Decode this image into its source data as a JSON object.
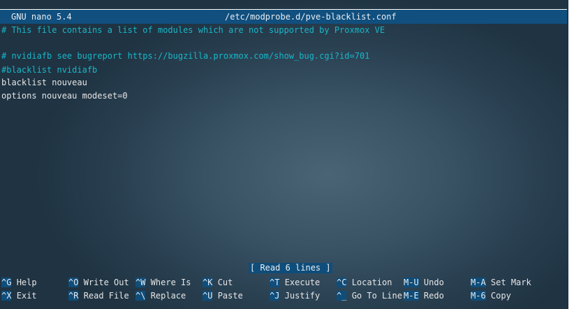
{
  "titlebar": {
    "app": "GNU nano 5.4",
    "file": "/etc/modprobe.d/pve-blacklist.conf"
  },
  "editor": {
    "lines": [
      {
        "text": "# This file contains a list of modules which are not supported by Proxmox VE",
        "kind": "comment"
      },
      {
        "text": "",
        "kind": "plain"
      },
      {
        "text": "# nvidiafb see bugreport https://bugzilla.proxmox.com/show_bug.cgi?id=701",
        "kind": "comment"
      },
      {
        "text": "#blacklist nvidiafb",
        "kind": "comment"
      },
      {
        "text": "blacklist nouveau",
        "kind": "plain"
      },
      {
        "text": "options nouveau modeset=0",
        "kind": "plain"
      }
    ]
  },
  "status": "[ Read 6 lines ]",
  "shortcuts": [
    {
      "key": "^G",
      "label": "Help"
    },
    {
      "key": "^O",
      "label": "Write Out"
    },
    {
      "key": "^W",
      "label": "Where Is"
    },
    {
      "key": "^K",
      "label": "Cut"
    },
    {
      "key": "^T",
      "label": "Execute"
    },
    {
      "key": "^C",
      "label": "Location"
    },
    {
      "key": "M-U",
      "label": "Undo"
    },
    {
      "key": "M-A",
      "label": "Set Mark"
    },
    {
      "key": "^X",
      "label": "Exit"
    },
    {
      "key": "^R",
      "label": "Read File"
    },
    {
      "key": "^\\",
      "label": "Replace"
    },
    {
      "key": "^U",
      "label": "Paste"
    },
    {
      "key": "^J",
      "label": "Justify"
    },
    {
      "key": "^_",
      "label": "Go To Line"
    },
    {
      "key": "M-E",
      "label": "Redo"
    },
    {
      "key": "M-6",
      "label": "Copy"
    }
  ]
}
